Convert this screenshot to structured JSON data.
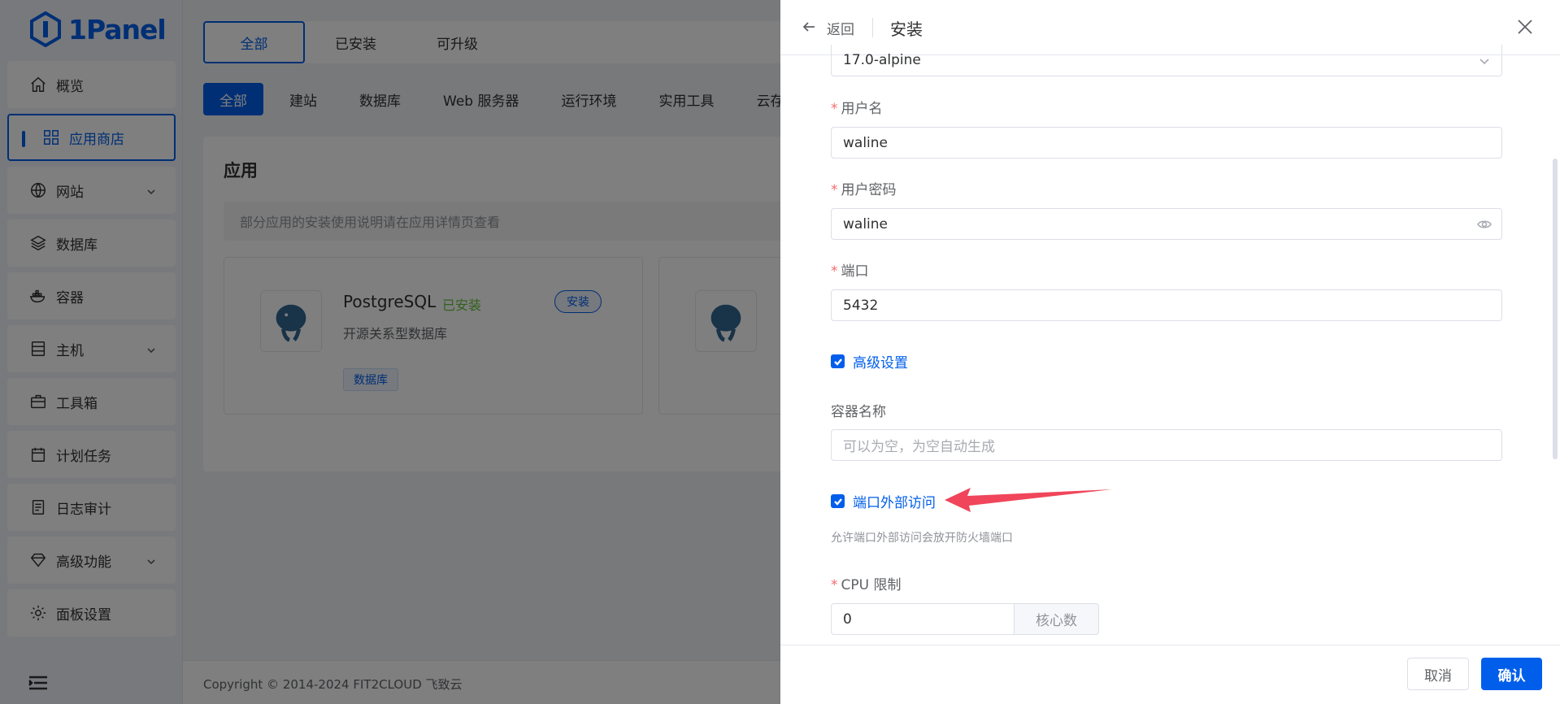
{
  "app": {
    "logo_text": "1Panel"
  },
  "sidebar": {
    "items": [
      {
        "label": "概览",
        "icon": "home-icon"
      },
      {
        "label": "应用商店",
        "icon": "grid-icon",
        "active": true
      },
      {
        "label": "网站",
        "icon": "globe-icon",
        "expandable": true
      },
      {
        "label": "数据库",
        "icon": "layers-icon"
      },
      {
        "label": "容器",
        "icon": "docker-icon"
      },
      {
        "label": "主机",
        "icon": "server-icon",
        "expandable": true
      },
      {
        "label": "工具箱",
        "icon": "toolbox-icon"
      },
      {
        "label": "计划任务",
        "icon": "calendar-icon"
      },
      {
        "label": "日志审计",
        "icon": "log-icon"
      },
      {
        "label": "高级功能",
        "icon": "diamond-icon",
        "expandable": true
      },
      {
        "label": "面板设置",
        "icon": "gear-icon"
      }
    ]
  },
  "main": {
    "tabs": [
      "全部",
      "已安装",
      "可升级"
    ],
    "categories": [
      "全部",
      "建站",
      "数据库",
      "Web 服务器",
      "运行环境",
      "实用工具",
      "云存"
    ],
    "section_title": "应用",
    "notice": "部分应用的安装使用说明请在应用详情页查看",
    "card": {
      "name": "PostgreSQL",
      "status": "已安装",
      "install_label": "安装",
      "description": "开源关系型数据库",
      "tag": "数据库"
    },
    "footer": "Copyright © 2014-2024 FIT2CLOUD 飞致云"
  },
  "drawer": {
    "back_label": "返回",
    "title": "安装",
    "version_value": "17.0-alpine",
    "username_label": "用户名",
    "username_value": "waline",
    "password_label": "用户密码",
    "password_value": "waline",
    "port_label": "端口",
    "port_value": "5432",
    "advanced_label": "高级设置",
    "container_name_label": "容器名称",
    "container_name_placeholder": "可以为空，为空自动生成",
    "external_access_label": "端口外部访问",
    "external_access_help": "允许端口外部访问会放开防火墙端口",
    "cpu_label": "CPU 限制",
    "cpu_value": "0",
    "cpu_unit": "核心数",
    "cancel_label": "取消",
    "confirm_label": "确认"
  },
  "colors": {
    "primary": "#005eeb",
    "annotation_arrow": "#f0455a",
    "success": "#67c23a"
  }
}
